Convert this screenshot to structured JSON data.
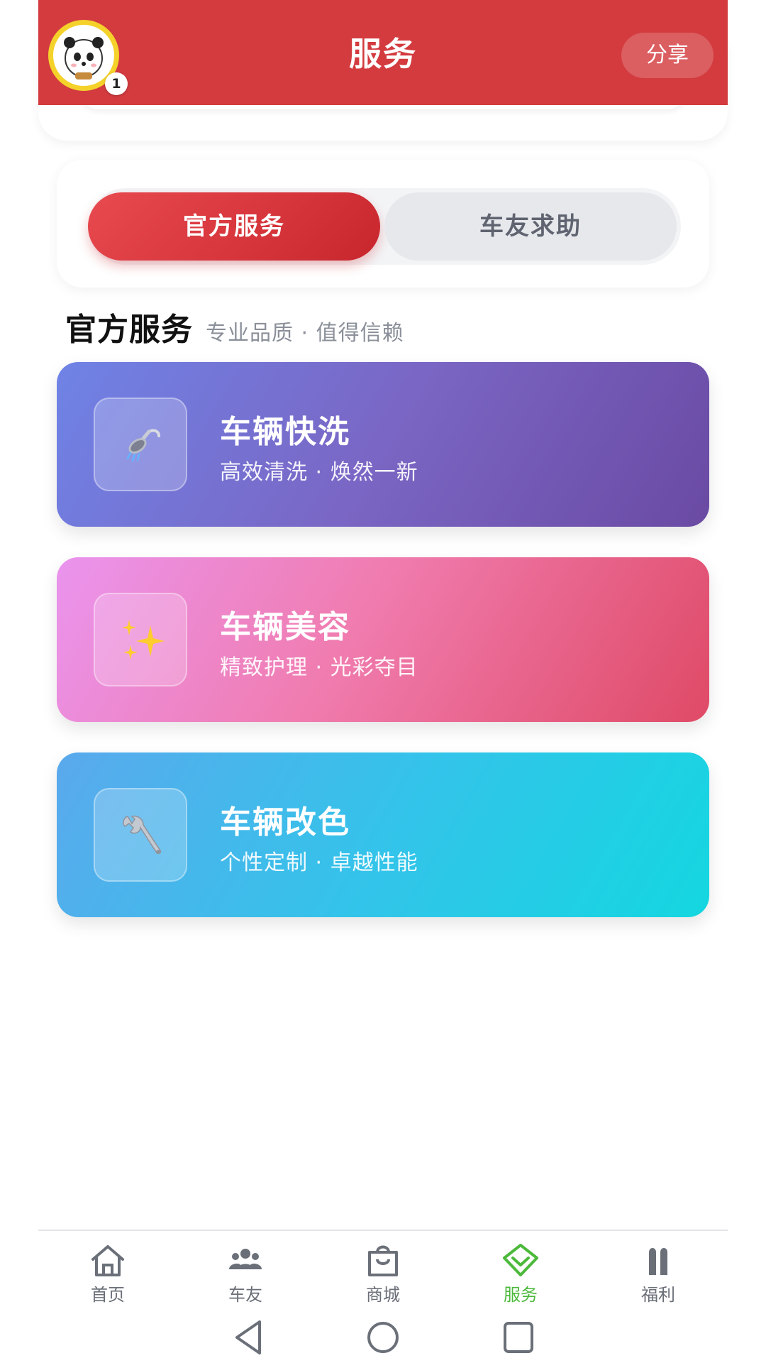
{
  "header": {
    "title": "服务",
    "share_label": "分享",
    "avatar_badge": "1"
  },
  "tabs": {
    "official": "官方服务",
    "help": "车友求助",
    "active": "official"
  },
  "section": {
    "title": "官方服务",
    "subtitle": "专业品质 · 值得信赖"
  },
  "services": [
    {
      "title": "车辆快洗",
      "subtitle": "高效清洗 · 焕然一新",
      "icon": "shower-icon"
    },
    {
      "title": "车辆美容",
      "subtitle": "精致护理 · 光彩夺目",
      "icon": "sparkles-icon"
    },
    {
      "title": "车辆改色",
      "subtitle": "个性定制 · 卓越性能",
      "icon": "wrench-icon"
    }
  ],
  "bottom_nav": [
    {
      "label": "首页",
      "icon": "home-icon"
    },
    {
      "label": "车友",
      "icon": "friends-icon"
    },
    {
      "label": "商城",
      "icon": "shopping-bag-icon"
    },
    {
      "label": "服务",
      "icon": "service-diamond-icon",
      "active": true
    },
    {
      "label": "福利",
      "icon": "benefits-icon"
    }
  ],
  "colors": {
    "header_red": "#d33b3f",
    "active_tab_red": "#d8353b",
    "nav_active_green": "#4cb93b",
    "avatar_ring": "#f4d22a"
  }
}
